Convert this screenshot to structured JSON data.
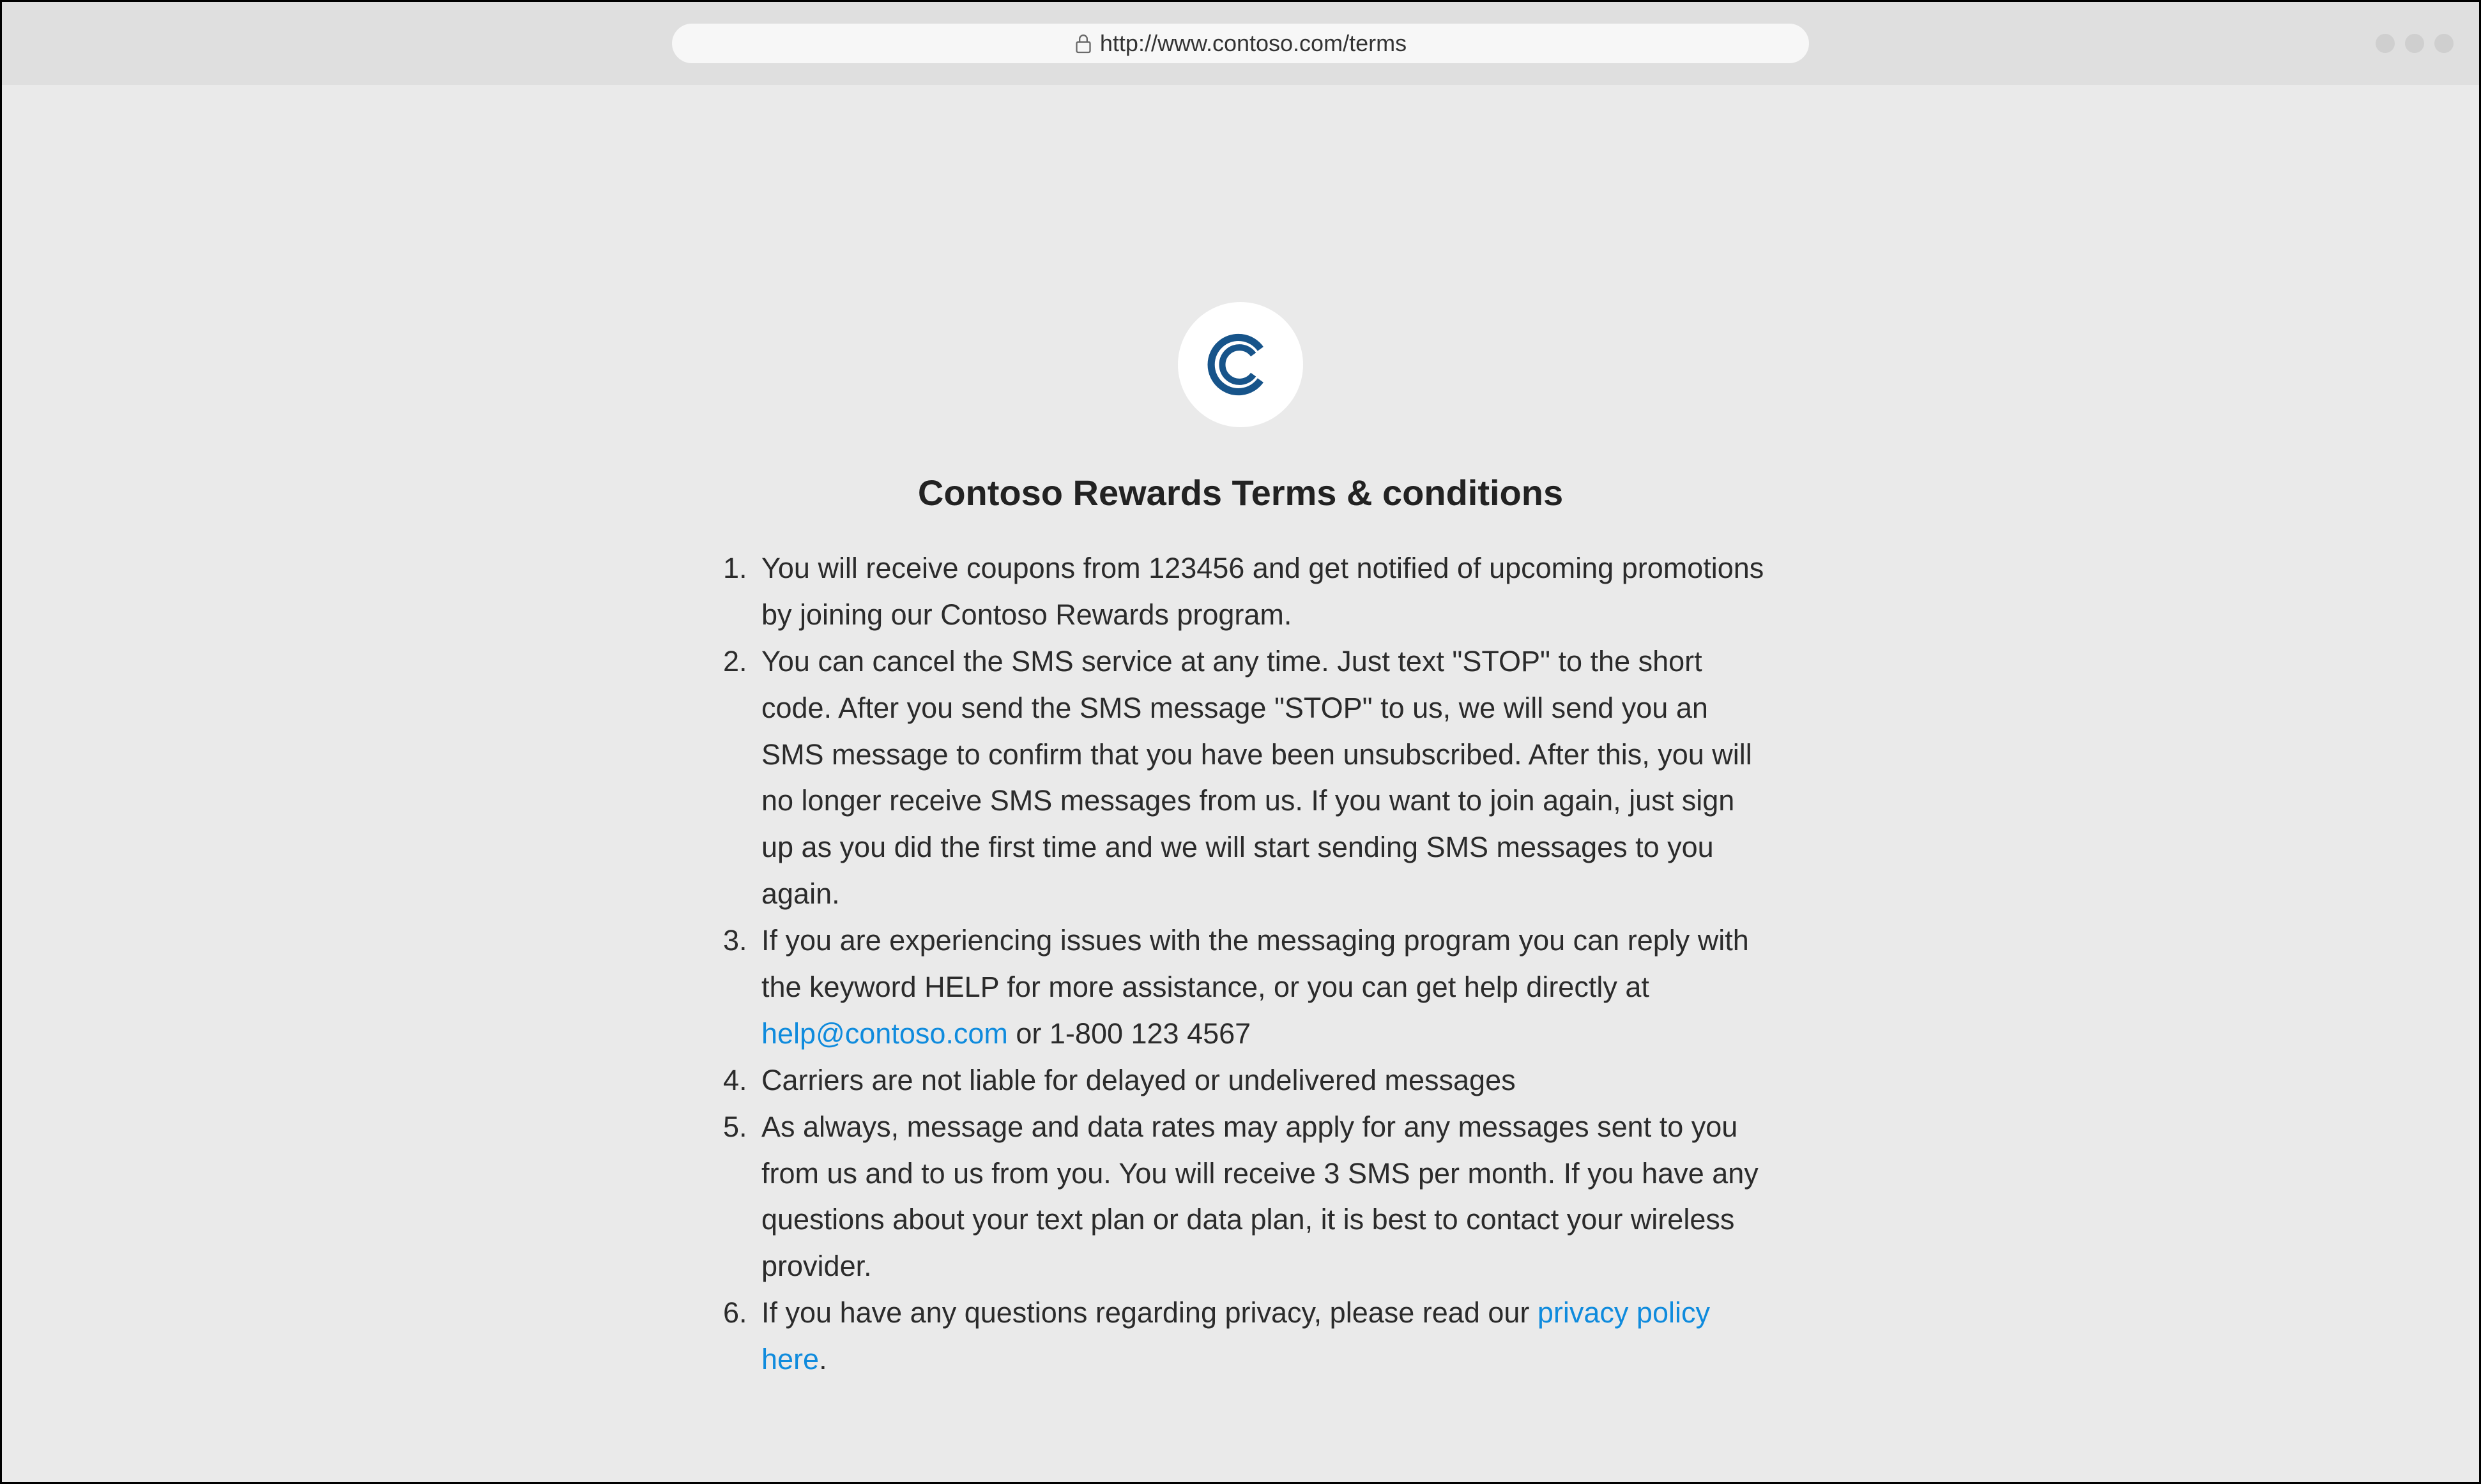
{
  "browser": {
    "url": "http://www.contoso.com/terms"
  },
  "page": {
    "title": "Contoso Rewards Terms & conditions",
    "terms": {
      "item1": "You will receive coupons from 123456 and get notified of upcoming promotions by joining our Contoso Rewards program.",
      "item2": "You can cancel the SMS service at any time. Just text \"STOP\" to the short code. After you send the SMS message \"STOP\" to us, we will send you an SMS message to confirm that you have been unsubscribed. After this, you will no longer receive SMS messages from us. If you want to join again, just sign up as you did the first time and we will start sending SMS messages to you again.",
      "item3_pre": "If you are experiencing issues with the messaging program you can reply with the keyword HELP for more assistance, or you can get help directly at ",
      "item3_link": "help@contoso.com",
      "item3_post": " or 1-800 123 4567",
      "item4": "Carriers are not liable for delayed or undelivered messages",
      "item5": "As always, message and data rates may apply for any messages sent to you from us and to us from you. You will receive 3 SMS per month. If you have any questions about your text plan or data plan, it is best to contact your wireless provider.",
      "item6_pre": " If you have any questions regarding privacy, please read our ",
      "item6_link": "privacy policy here",
      "item6_post": "."
    }
  }
}
